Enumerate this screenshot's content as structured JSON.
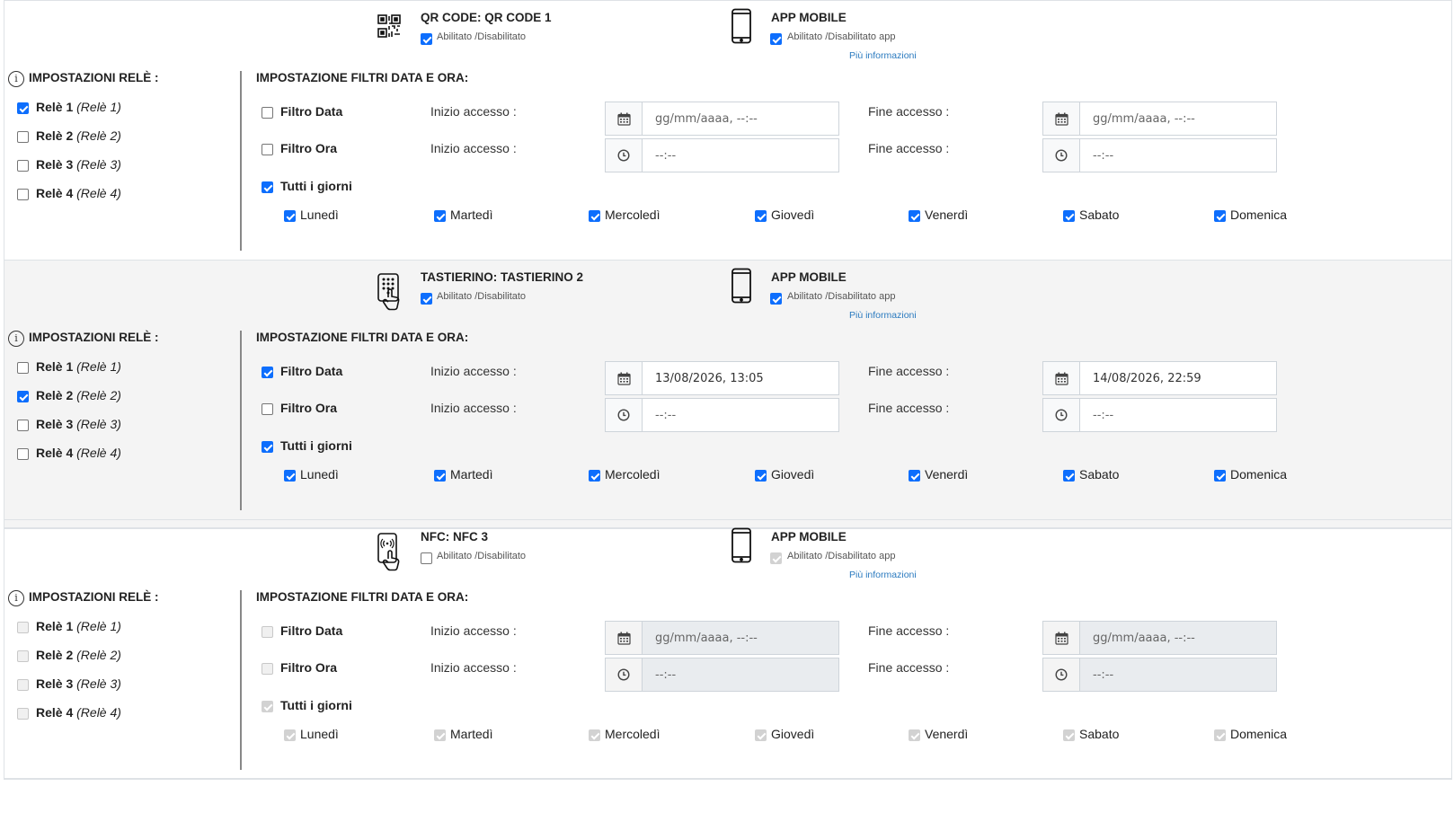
{
  "sections": [
    {
      "device_title": "QR CODE: QR CODE 1",
      "device_icon": "qr-code-icon",
      "device_enabled_label": "Abilitato /Disabilitato",
      "device_enabled": true,
      "app_title": "APP MOBILE",
      "app_icon": "smartphone-icon",
      "app_enabled_label": "Abilitato /Disabilitato app",
      "app_enabled": true,
      "app_disabled": false,
      "more_info": "Più informazioni",
      "relay_header": "IMPOSTAZIONI RELÈ :",
      "relays": [
        {
          "name": "Relè 1",
          "alias": "(Relè 1)",
          "checked": true
        },
        {
          "name": "Relè 2",
          "alias": "(Relè 2)",
          "checked": false
        },
        {
          "name": "Relè 3",
          "alias": "(Relè 3)",
          "checked": false
        },
        {
          "name": "Relè 4",
          "alias": "(Relè 4)",
          "checked": false
        }
      ],
      "filters_header": "IMPOSTAZIONE FILTRI DATA E ORA:",
      "date_filter": {
        "label": "Filtro Data",
        "checked": false,
        "start_label": "Inizio accesso :",
        "start_value": "gg/mm/aaaa, --:--",
        "end_label": "Fine accesso :",
        "end_value": "gg/mm/aaaa, --:--",
        "filled": false
      },
      "time_filter": {
        "label": "Filtro Ora",
        "checked": false,
        "start_label": "Inizio accesso :",
        "start_value": "--:--",
        "end_label": "Fine accesso :",
        "end_value": "--:--"
      },
      "all_days": {
        "label": "Tutti i giorni",
        "checked": true
      },
      "days": [
        {
          "label": "Lunedì",
          "checked": true
        },
        {
          "label": "Martedì",
          "checked": true
        },
        {
          "label": "Mercoledì",
          "checked": true
        },
        {
          "label": "Giovedì",
          "checked": true
        },
        {
          "label": "Venerdì",
          "checked": true
        },
        {
          "label": "Sabato",
          "checked": true
        },
        {
          "label": "Domenica",
          "checked": true
        }
      ],
      "disabled": false,
      "shaded": false
    },
    {
      "device_title": "TASTIERINO: TASTIERINO 2",
      "device_icon": "keypad-icon",
      "device_enabled_label": "Abilitato /Disabilitato",
      "device_enabled": true,
      "app_title": "APP MOBILE",
      "app_icon": "smartphone-icon",
      "app_enabled_label": "Abilitato /Disabilitato app",
      "app_enabled": true,
      "app_disabled": false,
      "more_info": "Più informazioni",
      "relay_header": "IMPOSTAZIONI RELÈ :",
      "relays": [
        {
          "name": "Relè 1",
          "alias": "(Relè 1)",
          "checked": false
        },
        {
          "name": "Relè 2",
          "alias": "(Relè 2)",
          "checked": true
        },
        {
          "name": "Relè 3",
          "alias": "(Relè 3)",
          "checked": false
        },
        {
          "name": "Relè 4",
          "alias": "(Relè 4)",
          "checked": false
        }
      ],
      "filters_header": "IMPOSTAZIONE FILTRI DATA E ORA:",
      "date_filter": {
        "label": "Filtro Data",
        "checked": true,
        "start_label": "Inizio accesso :",
        "start_value": "13/08/2026, 13:05",
        "end_label": "Fine accesso :",
        "end_value": "14/08/2026, 22:59",
        "filled": true
      },
      "time_filter": {
        "label": "Filtro Ora",
        "checked": false,
        "start_label": "Inizio accesso :",
        "start_value": "--:--",
        "end_label": "Fine accesso :",
        "end_value": "--:--"
      },
      "all_days": {
        "label": "Tutti i giorni",
        "checked": true
      },
      "days": [
        {
          "label": "Lunedì",
          "checked": true
        },
        {
          "label": "Martedì",
          "checked": true
        },
        {
          "label": "Mercoledì",
          "checked": true
        },
        {
          "label": "Giovedì",
          "checked": true
        },
        {
          "label": "Venerdì",
          "checked": true
        },
        {
          "label": "Sabato",
          "checked": true
        },
        {
          "label": "Domenica",
          "checked": true
        }
      ],
      "disabled": false,
      "shaded": true
    },
    {
      "device_title": "NFC: NFC 3",
      "device_icon": "nfc-tap-icon",
      "device_enabled_label": "Abilitato /Disabilitato",
      "device_enabled": false,
      "app_title": "APP MOBILE",
      "app_icon": "smartphone-icon",
      "app_enabled_label": "Abilitato /Disabilitato app",
      "app_enabled": true,
      "app_disabled": true,
      "more_info": "Più informazioni",
      "relay_header": "IMPOSTAZIONI RELÈ :",
      "relays": [
        {
          "name": "Relè 1",
          "alias": "(Relè 1)",
          "checked": false
        },
        {
          "name": "Relè 2",
          "alias": "(Relè 2)",
          "checked": false
        },
        {
          "name": "Relè 3",
          "alias": "(Relè 3)",
          "checked": false
        },
        {
          "name": "Relè 4",
          "alias": "(Relè 4)",
          "checked": false
        }
      ],
      "filters_header": "IMPOSTAZIONE FILTRI DATA E ORA:",
      "date_filter": {
        "label": "Filtro Data",
        "checked": false,
        "start_label": "Inizio accesso :",
        "start_value": "gg/mm/aaaa, --:--",
        "end_label": "Fine accesso :",
        "end_value": "gg/mm/aaaa, --:--",
        "filled": false
      },
      "time_filter": {
        "label": "Filtro Ora",
        "checked": false,
        "start_label": "Inizio accesso :",
        "start_value": "--:--",
        "end_label": "Fine accesso :",
        "end_value": "--:--"
      },
      "all_days": {
        "label": "Tutti i giorni",
        "checked": true
      },
      "days": [
        {
          "label": "Lunedì",
          "checked": true
        },
        {
          "label": "Martedì",
          "checked": true
        },
        {
          "label": "Mercoledì",
          "checked": true
        },
        {
          "label": "Giovedì",
          "checked": true
        },
        {
          "label": "Venerdì",
          "checked": true
        },
        {
          "label": "Sabato",
          "checked": true
        },
        {
          "label": "Domenica",
          "checked": true
        }
      ],
      "disabled": true,
      "shaded": false
    }
  ],
  "colors": {
    "accent": "#0d6efd",
    "link": "#2a7abf",
    "shaded_bg": "#f4f4f4",
    "disabled_input": "#e9ecef"
  }
}
